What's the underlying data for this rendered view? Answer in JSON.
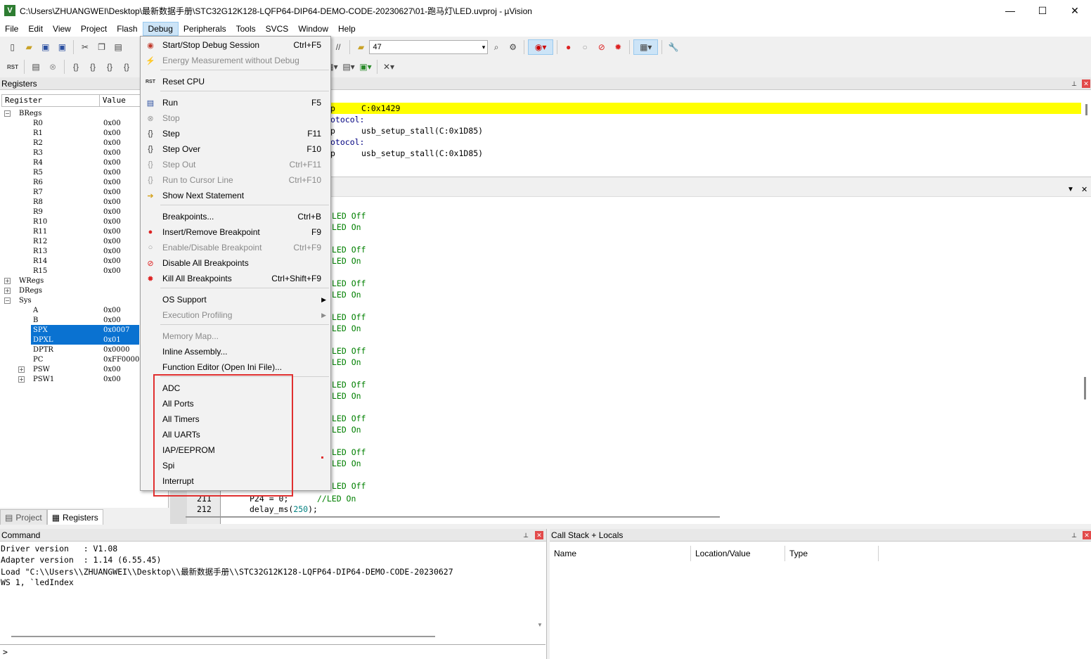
{
  "window": {
    "title": "C:\\Users\\ZHUANGWEI\\Desktop\\最新数据手册\\STC32G12K128-LQFP64-DIP64-DEMO-CODE-20230627\\01-跑马灯\\LED.uvproj - µVision",
    "minimize": "—",
    "maximize": "☐",
    "close": "✕"
  },
  "menubar": [
    "File",
    "Edit",
    "View",
    "Project",
    "Flash",
    "Debug",
    "Peripherals",
    "Tools",
    "SVCS",
    "Window",
    "Help"
  ],
  "toolbar": {
    "combo_value": "47"
  },
  "registers_panel": {
    "title": "Registers",
    "col_register": "Register",
    "col_value": "Value",
    "rows": [
      {
        "name": "BRegs",
        "value": "",
        "type": "group"
      },
      {
        "name": "R0",
        "value": "0x00"
      },
      {
        "name": "R1",
        "value": "0x00"
      },
      {
        "name": "R2",
        "value": "0x00"
      },
      {
        "name": "R3",
        "value": "0x00"
      },
      {
        "name": "R4",
        "value": "0x00"
      },
      {
        "name": "R5",
        "value": "0x00"
      },
      {
        "name": "R6",
        "value": "0x00"
      },
      {
        "name": "R7",
        "value": "0x00"
      },
      {
        "name": "R8",
        "value": "0x00"
      },
      {
        "name": "R9",
        "value": "0x00"
      },
      {
        "name": "R10",
        "value": "0x00"
      },
      {
        "name": "R11",
        "value": "0x00"
      },
      {
        "name": "R12",
        "value": "0x00"
      },
      {
        "name": "R13",
        "value": "0x00"
      },
      {
        "name": "R14",
        "value": "0x00"
      },
      {
        "name": "R15",
        "value": "0x00"
      },
      {
        "name": "WRegs",
        "value": "",
        "type": "group"
      },
      {
        "name": "DRegs",
        "value": "",
        "type": "group"
      },
      {
        "name": "Sys",
        "value": "",
        "type": "group"
      },
      {
        "name": "A",
        "value": "0x00"
      },
      {
        "name": "B",
        "value": "0x00"
      },
      {
        "name": "SPX",
        "value": "0x0007",
        "selected": true
      },
      {
        "name": "DPXL",
        "value": "0x01",
        "selected": true
      },
      {
        "name": "DPTR",
        "value": "0x0000"
      },
      {
        "name": "PC",
        "value": "0xFF0000"
      },
      {
        "name": "PSW",
        "value": "0x00",
        "type": "sub"
      },
      {
        "name": "PSW1",
        "value": "0x00",
        "type": "sub"
      }
    ]
  },
  "left_tabs": [
    "Project",
    "Registers"
  ],
  "disassembly": {
    "lines": [
      {
        "a": "p",
        "b": "C:0x1429",
        "highlight": true
      },
      {
        "a": "otocol:",
        "b": ""
      },
      {
        "a": "p",
        "b": "usb_setup_stall(C:0x1D85)"
      },
      {
        "a": "otocol:",
        "b": ""
      },
      {
        "a": "p",
        "b": "usb_setup_stall(C:0x1D85)"
      }
    ]
  },
  "editor": {
    "comments": [
      "LED Off",
      "LED On",
      "LED Off",
      "LED On",
      "LED Off",
      "LED On",
      "LED Off",
      "LED On",
      "LED Off",
      "LED On",
      "LED Off",
      "LED On",
      "LED Off",
      "LED On",
      "LED Off",
      "LED On",
      "LED Off"
    ],
    "line211_num": "211",
    "line211_code": "P24 = 0;",
    "line211_comment": "//LED On",
    "line212_num": "212",
    "line212_code": "delay_ms(",
    "line212_arg": "250",
    "line212_end": ");"
  },
  "debug_menu": {
    "items": [
      {
        "label": "Start/Stop Debug Session",
        "key": "Ctrl+F5",
        "icon": "debug-session-icon"
      },
      {
        "label": "Energy Measurement without Debug",
        "key": "",
        "disabled": true,
        "icon": "energy-icon"
      },
      {
        "label": "Reset CPU",
        "key": "",
        "icon": "reset-cpu-icon"
      },
      {
        "label": "Run",
        "key": "F5",
        "icon": "run-icon"
      },
      {
        "label": "Stop",
        "key": "",
        "disabled": true,
        "icon": "stop-icon"
      },
      {
        "label": "Step",
        "key": "F11",
        "icon": "step-icon"
      },
      {
        "label": "Step Over",
        "key": "F10",
        "icon": "step-over-icon"
      },
      {
        "label": "Step Out",
        "key": "Ctrl+F11",
        "disabled": true,
        "icon": "step-out-icon"
      },
      {
        "label": "Run to Cursor Line",
        "key": "Ctrl+F10",
        "disabled": true,
        "icon": "run-to-cursor-icon"
      },
      {
        "label": "Show Next Statement",
        "key": "",
        "icon": "arrow-right-icon"
      },
      {
        "label": "Breakpoints...",
        "key": "Ctrl+B",
        "icon": ""
      },
      {
        "label": "Insert/Remove Breakpoint",
        "key": "F9",
        "icon": "breakpoint-icon"
      },
      {
        "label": "Enable/Disable Breakpoint",
        "key": "Ctrl+F9",
        "disabled": true,
        "icon": "breakpoint-outline-icon"
      },
      {
        "label": "Disable All Breakpoints",
        "key": "",
        "icon": "disable-breakpoints-icon"
      },
      {
        "label": "Kill All Breakpoints",
        "key": "Ctrl+Shift+F9",
        "icon": "kill-breakpoints-icon"
      },
      {
        "label": "OS Support",
        "key": "",
        "submenu": true
      },
      {
        "label": "Execution Profiling",
        "key": "",
        "submenu": true,
        "disabled": true
      },
      {
        "label": "Memory Map...",
        "key": "",
        "disabled": true
      },
      {
        "label": "Inline Assembly...",
        "key": ""
      },
      {
        "label": "Function Editor (Open Ini File)...",
        "key": ""
      },
      {
        "label": "ADC",
        "key": ""
      },
      {
        "label": "All Ports",
        "key": ""
      },
      {
        "label": "All Timers",
        "key": ""
      },
      {
        "label": "All UARTs",
        "key": ""
      },
      {
        "label": "IAP/EEPROM",
        "key": ""
      },
      {
        "label": "Spi",
        "key": ""
      },
      {
        "label": "Interrupt",
        "key": ""
      }
    ]
  },
  "command_panel": {
    "title": "Command",
    "lines": [
      "Driver version   : V1.08",
      "Adapter version  : 1.14 (6.55.45)",
      "Load \"C:\\\\Users\\\\ZHUANGWEI\\\\Desktop\\\\最新数据手册\\\\STC32G12K128-LQFP64-DIP64-DEMO-CODE-20230627",
      "WS 1, `ledIndex"
    ],
    "prompt": ">"
  },
  "callstack_panel": {
    "title": "Call Stack + Locals",
    "columns": [
      "Name",
      "Location/Value",
      "Type"
    ]
  },
  "colors": {
    "highlight_yellow": "#ffff00",
    "comment_green": "#008000",
    "selection_blue": "#0a72d1",
    "menu_active": "#cce4f7",
    "annotation_red": "#e03030"
  }
}
